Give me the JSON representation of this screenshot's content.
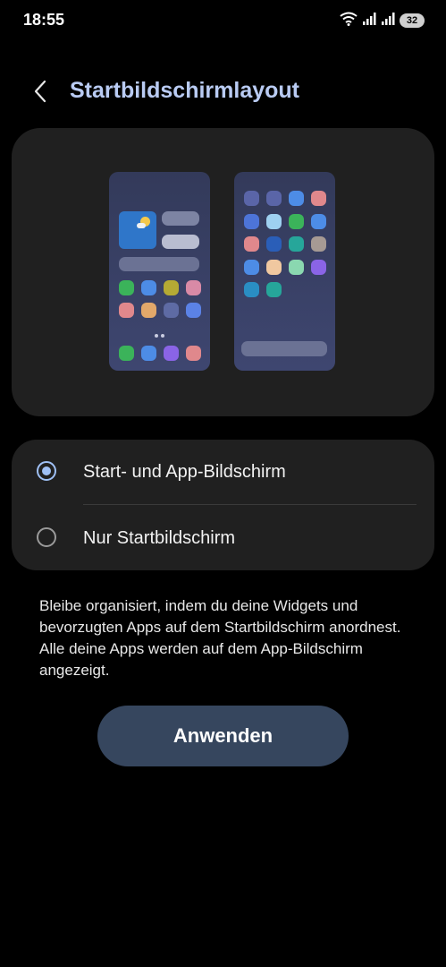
{
  "status_bar": {
    "time": "18:55",
    "battery_level": "32",
    "icons": [
      "wifi-icon",
      "signal-icon",
      "signal-icon",
      "battery-icon"
    ]
  },
  "header": {
    "back_icon": "chevron-left-icon",
    "title": "Startbildschirmlayout"
  },
  "preview": {
    "left_phone_icon_colors": [
      "#3bb35a",
      "#4d8ce6",
      "#b5aa34",
      "#d98aa6",
      "#e0888c",
      "#e2a86a",
      "#5e6ba4",
      "#5b82e6"
    ],
    "left_phone_dock_colors": [
      "#3bb35a",
      "#4d8ce6",
      "#8a64e6",
      "#e0888c"
    ],
    "right_phone_icon_colors": [
      "#5a65a8",
      "#5a65a8",
      "#4d8ce6",
      "#e0888c",
      "#4d74d8",
      "#9ed0f0",
      "#3bb35a",
      "#4d8ce6",
      "#e0888c",
      "#2a5eb8",
      "#26a69a",
      "#a69a94",
      "#4d8ce6",
      "#f0c8a0",
      "#8ad8b0",
      "#8a64e6",
      "#2a8ec4",
      "#26a69a"
    ]
  },
  "options": [
    {
      "label": "Start- und App-Bildschirm",
      "selected": true
    },
    {
      "label": "Nur Startbildschirm",
      "selected": false
    }
  ],
  "description": "Bleibe organisiert, indem du deine Widgets und bevorzugten Apps auf dem Startbildschirm anordnest. Alle deine Apps werden auf dem App-Bildschirm angezeigt.",
  "apply_button": {
    "label": "Anwenden"
  },
  "colors": {
    "background": "#000000",
    "card": "#202020",
    "title_accent": "#b9cbf3",
    "radio_accent": "#9fc0f5",
    "button": "#36465e"
  }
}
